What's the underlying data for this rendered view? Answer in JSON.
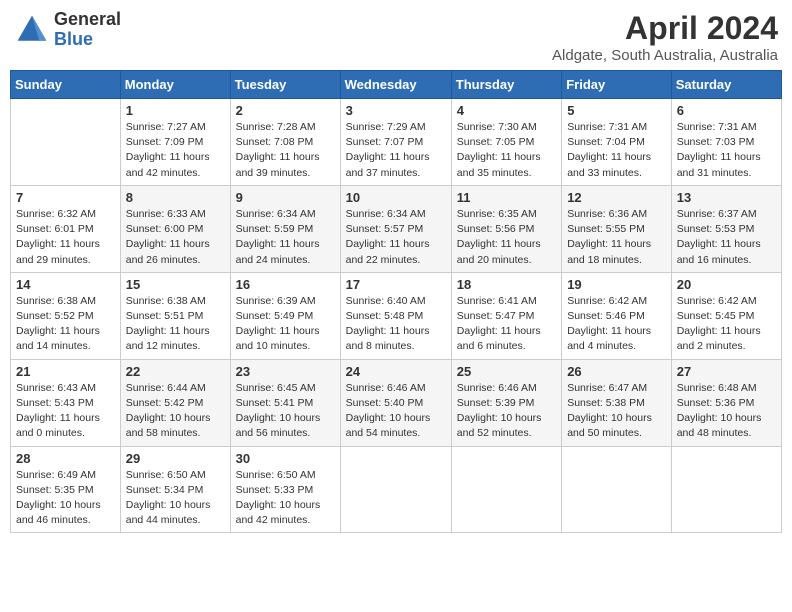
{
  "header": {
    "logo_general": "General",
    "logo_blue": "Blue",
    "month_title": "April 2024",
    "location": "Aldgate, South Australia, Australia"
  },
  "days_of_week": [
    "Sunday",
    "Monday",
    "Tuesday",
    "Wednesday",
    "Thursday",
    "Friday",
    "Saturday"
  ],
  "weeks": [
    [
      {
        "day": "",
        "info": ""
      },
      {
        "day": "1",
        "info": "Sunrise: 7:27 AM\nSunset: 7:09 PM\nDaylight: 11 hours\nand 42 minutes."
      },
      {
        "day": "2",
        "info": "Sunrise: 7:28 AM\nSunset: 7:08 PM\nDaylight: 11 hours\nand 39 minutes."
      },
      {
        "day": "3",
        "info": "Sunrise: 7:29 AM\nSunset: 7:07 PM\nDaylight: 11 hours\nand 37 minutes."
      },
      {
        "day": "4",
        "info": "Sunrise: 7:30 AM\nSunset: 7:05 PM\nDaylight: 11 hours\nand 35 minutes."
      },
      {
        "day": "5",
        "info": "Sunrise: 7:31 AM\nSunset: 7:04 PM\nDaylight: 11 hours\nand 33 minutes."
      },
      {
        "day": "6",
        "info": "Sunrise: 7:31 AM\nSunset: 7:03 PM\nDaylight: 11 hours\nand 31 minutes."
      }
    ],
    [
      {
        "day": "7",
        "info": "Sunrise: 6:32 AM\nSunset: 6:01 PM\nDaylight: 11 hours\nand 29 minutes."
      },
      {
        "day": "8",
        "info": "Sunrise: 6:33 AM\nSunset: 6:00 PM\nDaylight: 11 hours\nand 26 minutes."
      },
      {
        "day": "9",
        "info": "Sunrise: 6:34 AM\nSunset: 5:59 PM\nDaylight: 11 hours\nand 24 minutes."
      },
      {
        "day": "10",
        "info": "Sunrise: 6:34 AM\nSunset: 5:57 PM\nDaylight: 11 hours\nand 22 minutes."
      },
      {
        "day": "11",
        "info": "Sunrise: 6:35 AM\nSunset: 5:56 PM\nDaylight: 11 hours\nand 20 minutes."
      },
      {
        "day": "12",
        "info": "Sunrise: 6:36 AM\nSunset: 5:55 PM\nDaylight: 11 hours\nand 18 minutes."
      },
      {
        "day": "13",
        "info": "Sunrise: 6:37 AM\nSunset: 5:53 PM\nDaylight: 11 hours\nand 16 minutes."
      }
    ],
    [
      {
        "day": "14",
        "info": "Sunrise: 6:38 AM\nSunset: 5:52 PM\nDaylight: 11 hours\nand 14 minutes."
      },
      {
        "day": "15",
        "info": "Sunrise: 6:38 AM\nSunset: 5:51 PM\nDaylight: 11 hours\nand 12 minutes."
      },
      {
        "day": "16",
        "info": "Sunrise: 6:39 AM\nSunset: 5:49 PM\nDaylight: 11 hours\nand 10 minutes."
      },
      {
        "day": "17",
        "info": "Sunrise: 6:40 AM\nSunset: 5:48 PM\nDaylight: 11 hours\nand 8 minutes."
      },
      {
        "day": "18",
        "info": "Sunrise: 6:41 AM\nSunset: 5:47 PM\nDaylight: 11 hours\nand 6 minutes."
      },
      {
        "day": "19",
        "info": "Sunrise: 6:42 AM\nSunset: 5:46 PM\nDaylight: 11 hours\nand 4 minutes."
      },
      {
        "day": "20",
        "info": "Sunrise: 6:42 AM\nSunset: 5:45 PM\nDaylight: 11 hours\nand 2 minutes."
      }
    ],
    [
      {
        "day": "21",
        "info": "Sunrise: 6:43 AM\nSunset: 5:43 PM\nDaylight: 11 hours\nand 0 minutes."
      },
      {
        "day": "22",
        "info": "Sunrise: 6:44 AM\nSunset: 5:42 PM\nDaylight: 10 hours\nand 58 minutes."
      },
      {
        "day": "23",
        "info": "Sunrise: 6:45 AM\nSunset: 5:41 PM\nDaylight: 10 hours\nand 56 minutes."
      },
      {
        "day": "24",
        "info": "Sunrise: 6:46 AM\nSunset: 5:40 PM\nDaylight: 10 hours\nand 54 minutes."
      },
      {
        "day": "25",
        "info": "Sunrise: 6:46 AM\nSunset: 5:39 PM\nDaylight: 10 hours\nand 52 minutes."
      },
      {
        "day": "26",
        "info": "Sunrise: 6:47 AM\nSunset: 5:38 PM\nDaylight: 10 hours\nand 50 minutes."
      },
      {
        "day": "27",
        "info": "Sunrise: 6:48 AM\nSunset: 5:36 PM\nDaylight: 10 hours\nand 48 minutes."
      }
    ],
    [
      {
        "day": "28",
        "info": "Sunrise: 6:49 AM\nSunset: 5:35 PM\nDaylight: 10 hours\nand 46 minutes."
      },
      {
        "day": "29",
        "info": "Sunrise: 6:50 AM\nSunset: 5:34 PM\nDaylight: 10 hours\nand 44 minutes."
      },
      {
        "day": "30",
        "info": "Sunrise: 6:50 AM\nSunset: 5:33 PM\nDaylight: 10 hours\nand 42 minutes."
      },
      {
        "day": "",
        "info": ""
      },
      {
        "day": "",
        "info": ""
      },
      {
        "day": "",
        "info": ""
      },
      {
        "day": "",
        "info": ""
      }
    ]
  ]
}
